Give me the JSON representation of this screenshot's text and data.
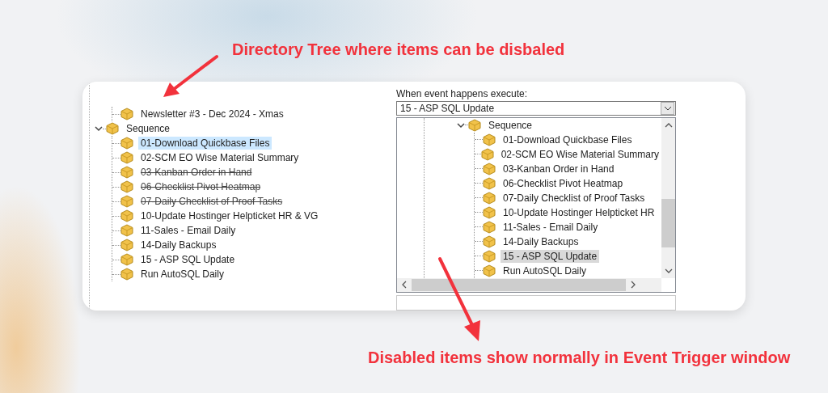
{
  "top_callout": {
    "text": "Directory Tree where items can be disbaled"
  },
  "left_tree": {
    "items": [
      {
        "children": [
          {
            "label": "Newsletter #3 - Dec 2024 - Xmas",
            "selected": false,
            "disabled": false
          }
        ]
      },
      {
        "label": "Sequence",
        "expanded": true,
        "selected": false,
        "disabled": false,
        "children": [
          {
            "label": "01-Download Quickbase Files",
            "selected": true,
            "disabled": false
          },
          {
            "label": "02-SCM EO Wise Material Summary",
            "selected": false,
            "disabled": false
          },
          {
            "label": "03-Kanban Order in Hand",
            "selected": false,
            "disabled": true
          },
          {
            "label": "06-Checklist Pivot Heatmap",
            "selected": false,
            "disabled": true
          },
          {
            "label": "07-Daily Checklist of  Proof Tasks",
            "selected": false,
            "disabled": true
          },
          {
            "label": "10-Update Hostinger Helpticket HR & VG",
            "selected": false,
            "disabled": false
          },
          {
            "label": "11-Sales - Email Daily",
            "selected": false,
            "disabled": false
          },
          {
            "label": "14-Daily Backups",
            "selected": false,
            "disabled": false
          },
          {
            "label": "15 - ASP SQL Update",
            "selected": false,
            "disabled": false
          },
          {
            "label": "Run AutoSQL Daily",
            "selected": false,
            "disabled": false
          }
        ]
      }
    ]
  },
  "event_panel": {
    "label": "When event happens execute:",
    "dropdown": {
      "value": "15 - ASP SQL Update"
    },
    "tree": {
      "items": [
        {
          "label": "Sequence",
          "expanded": true,
          "selected": false,
          "children": [
            {
              "label": "01-Download Quickbase Files",
              "selected": false
            },
            {
              "label": "02-SCM EO Wise Material Summary",
              "selected": false
            },
            {
              "label": "03-Kanban Order in Hand",
              "selected": false
            },
            {
              "label": "06-Checklist Pivot Heatmap",
              "selected": false
            },
            {
              "label": "07-Daily Checklist of  Proof Tasks",
              "selected": false
            },
            {
              "label": "10-Update Hostinger Helpticket HR",
              "selected": false
            },
            {
              "label": "11-Sales - Email Daily",
              "selected": false
            },
            {
              "label": "14-Daily Backups",
              "selected": false
            },
            {
              "label": "15 - ASP SQL Update",
              "selected": true
            },
            {
              "label": "Run AutoSQL Daily",
              "selected": false
            }
          ]
        }
      ]
    }
  },
  "bottom_callout": {
    "text": "Disabled items show normally in Event Trigger window"
  }
}
